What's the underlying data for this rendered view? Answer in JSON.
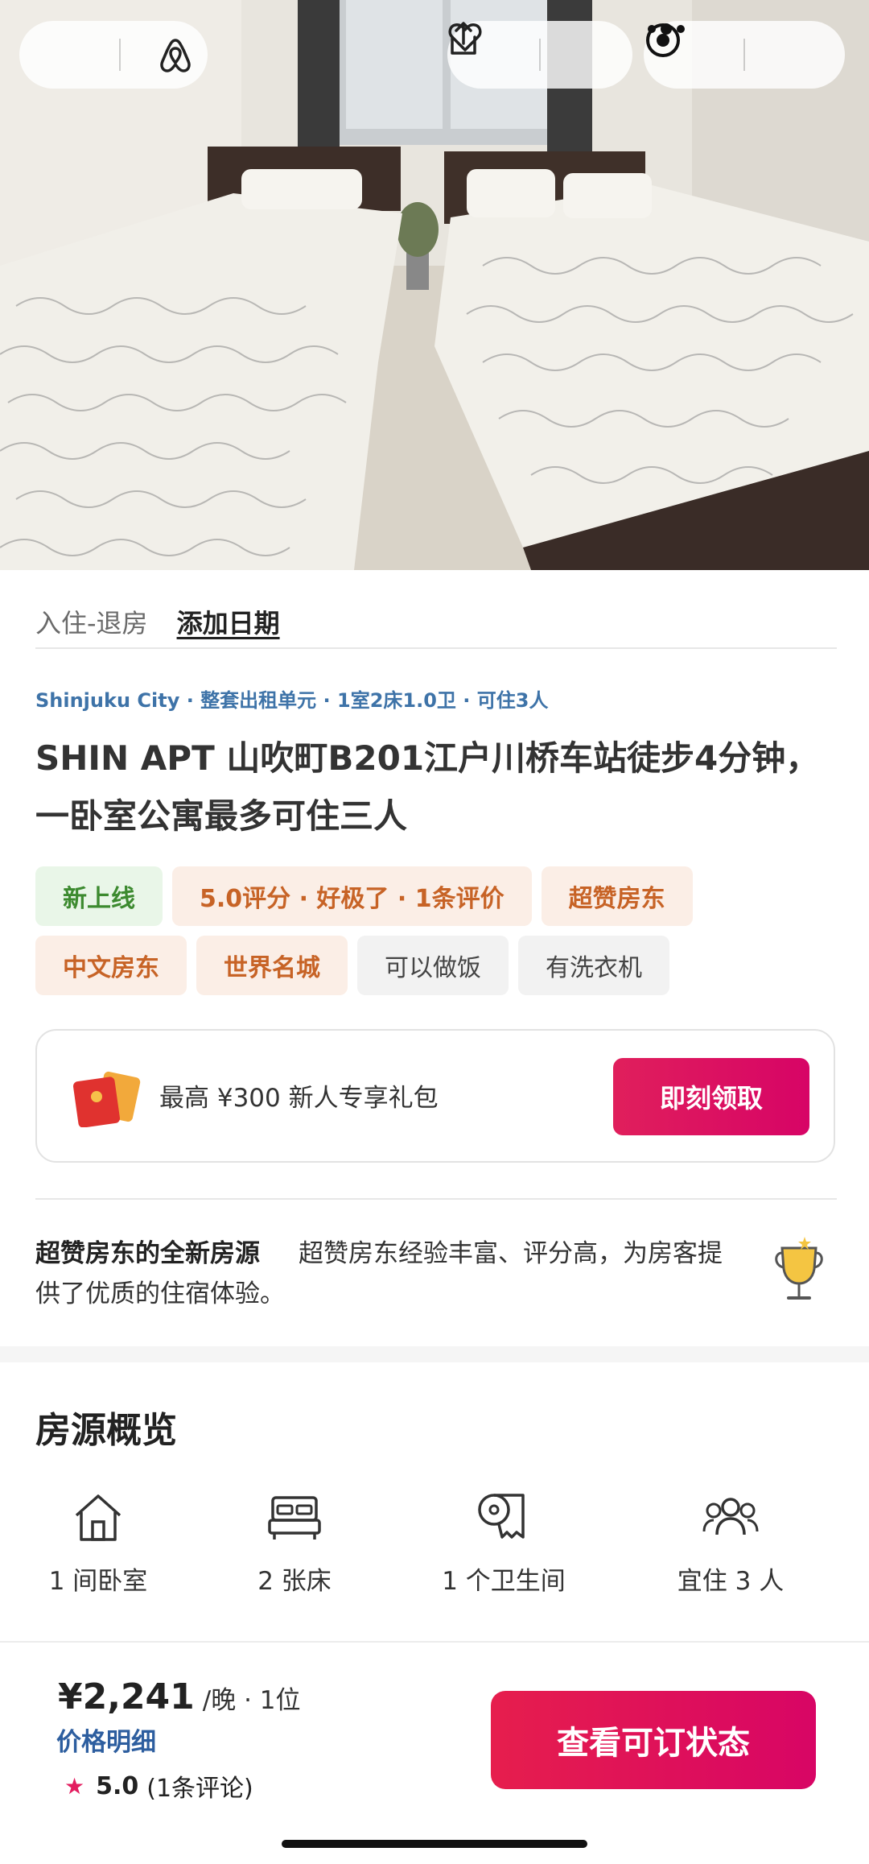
{
  "hero": {
    "photo_alt": "bedroom photo",
    "icons": {
      "brand": "airbnb-logo-icon",
      "share": "share-icon",
      "favorite": "heart-icon",
      "more": "more-dots-icon",
      "close": "target-icon"
    }
  },
  "dates": {
    "label": "入住-退房",
    "action": "添加日期"
  },
  "listing": {
    "meta": "Shinjuku City · 整套出租单元 · 1室2床1.0卫 · 可住3人",
    "title": "SHIN APT 山吹町B201江户川桥车站徒步4分钟，一卧室公寓最多可住三人",
    "tags": [
      {
        "label": "新上线",
        "style": "green"
      },
      {
        "label": "5.0评分 · 好极了 · 1条评价",
        "style": "orange"
      },
      {
        "label": "超赞房东",
        "style": "orange"
      },
      {
        "label": "中文房东",
        "style": "orange"
      },
      {
        "label": "世界名城",
        "style": "orange"
      },
      {
        "label": "可以做饭",
        "style": "gray"
      },
      {
        "label": "有洗衣机",
        "style": "gray"
      }
    ]
  },
  "promo": {
    "text": "最高 ¥300 新人专享礼包",
    "button": "即刻领取",
    "icon": "red-envelope-icon"
  },
  "superhost": {
    "title": "超赞房东的全新房源",
    "text": "超赞房东经验丰富、评分高，为房客提供了优质的住宿体验。",
    "icon": "trophy-icon"
  },
  "overview": {
    "title": "房源概览",
    "items": [
      {
        "icon": "house-icon",
        "label": "1 间卧室"
      },
      {
        "icon": "bed-icon",
        "label": "2 张床"
      },
      {
        "icon": "toilet-paper-icon",
        "label": "1 个卫生间"
      },
      {
        "icon": "guests-icon",
        "label": "宜住 3 人"
      }
    ]
  },
  "booking": {
    "price": "¥2,241",
    "unit": "/晚 · 1位",
    "price_detail": "价格明细",
    "rating": "5.0",
    "reviews": "(1条评论)",
    "button": "查看可订状态"
  },
  "colors": {
    "accent": "#e31c5f",
    "link_blue": "#2d5e9f",
    "meta_blue": "#3e73a8"
  }
}
